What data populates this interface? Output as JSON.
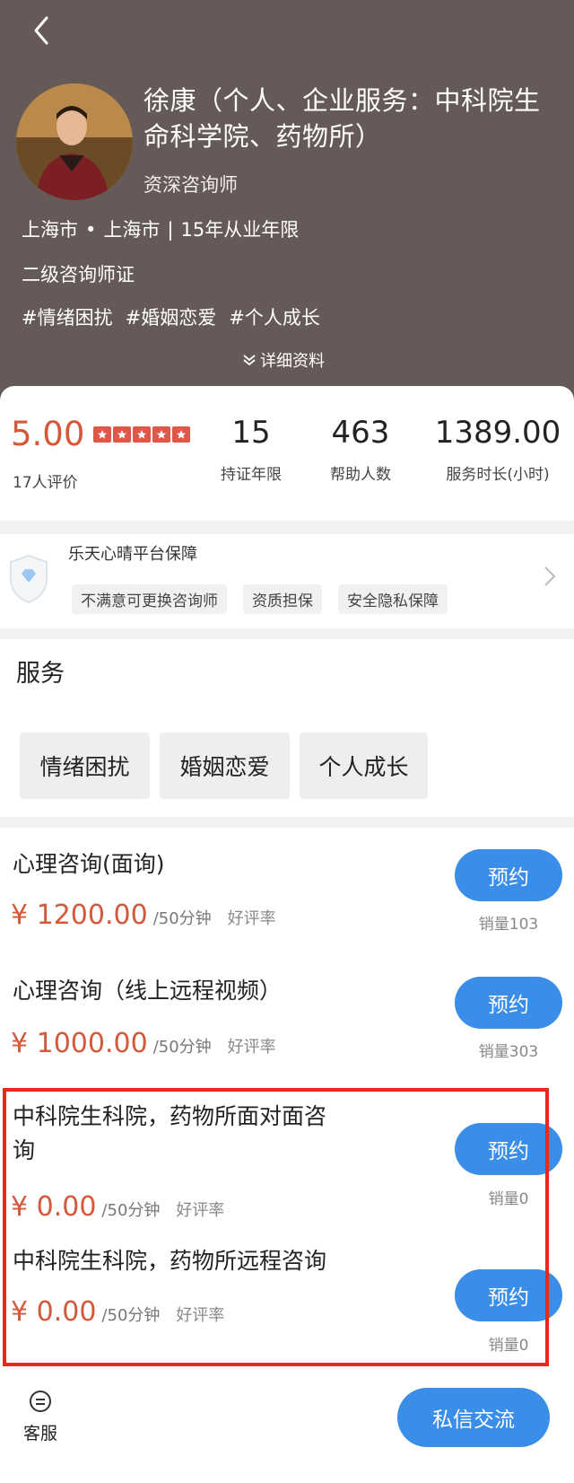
{
  "header": {
    "name": "徐康（个人、企业服务：中科院生命科学院、药物所）",
    "title": "资深咨询师",
    "province": "上海市",
    "city": "上海市",
    "experience": "15年从业年限",
    "certificate": "二级咨询师证",
    "tags": [
      "#情绪困扰",
      "#婚姻恋爱",
      "#个人成长"
    ],
    "detail_link": "详细资料"
  },
  "stats": {
    "rating": "5.00",
    "reviews": "17人评价",
    "items": [
      {
        "value": "15",
        "label": "持证年限"
      },
      {
        "value": "463",
        "label": "帮助人数"
      },
      {
        "value": "1389.00",
        "label": "服务时长(小时)"
      }
    ]
  },
  "guarantee": {
    "title": "乐天心晴平台保障",
    "tags": [
      "不满意可更换咨询师",
      "资质担保",
      "安全隐私保障"
    ]
  },
  "services": {
    "heading": "服务",
    "tags": [
      "情绪困扰",
      "婚姻恋爱",
      "个人成长"
    ]
  },
  "offerings": [
    {
      "name": "心理咨询(面询)",
      "price": "¥ 1200.00",
      "unit": "/50分钟",
      "rate_label": "好评率",
      "button": "预约",
      "sales": "销量103"
    },
    {
      "name": "心理咨询（线上远程视频）",
      "price": "¥ 1000.00",
      "unit": "/50分钟",
      "rate_label": "好评率",
      "button": "预约",
      "sales": "销量303"
    },
    {
      "name_line1": "中科院生科院，药物所面对面咨",
      "name_line2": "询",
      "price": "¥ 0.00",
      "unit": "/50分钟",
      "rate_label": "好评率",
      "button": "预约",
      "sales": "销量0"
    },
    {
      "name": "中科院生科院，药物所远程咨询",
      "price": "¥ 0.00",
      "unit": "/50分钟",
      "rate_label": "好评率",
      "button": "预约",
      "sales": "销量0"
    }
  ],
  "footer": {
    "service_label": "客服",
    "message_button": "私信交流"
  },
  "colors": {
    "header_bg": "#655a57",
    "accent_red": "#d4583a",
    "button_blue": "#3a8ee8",
    "highlight_border": "#e8281c"
  }
}
